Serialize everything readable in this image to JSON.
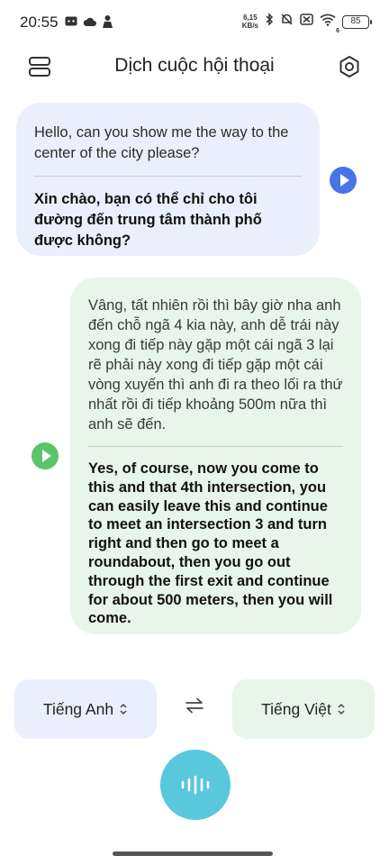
{
  "status_bar": {
    "time": "20:55",
    "net_speed_value": "6,15",
    "net_speed_unit": "KB/s",
    "wifi_badge": "6",
    "battery": "85",
    "icons": [
      "message-icon",
      "cloud-icon",
      "incognito-icon",
      "bluetooth-icon",
      "mute-icon",
      "sim-off-icon",
      "wifi-icon",
      "battery-icon"
    ]
  },
  "header": {
    "title": "Dịch cuộc hội thoại",
    "left_icon": "history-icon",
    "right_icon": "settings-icon"
  },
  "conversation": [
    {
      "source_text": "Hello, can you show me the way to the center of the city please?",
      "translated_text": "Xin chào, bạn có thể chỉ cho tôi đường đến trung tâm thành phố được không?",
      "accent": "#4a73e8"
    },
    {
      "source_text": "Vâng, tất nhiên rồi thì bây giờ nha anh đến chỗ ngã 4 kia này, anh dễ trái này xong đi tiếp này gặp một cái ngã 3 lại rẽ phải này xong đi tiếp gặp một cái vòng xuyến thì anh đi ra theo lối ra thứ nhất rồi đi tiếp khoảng 500m nữa thì anh sẽ đến.",
      "translated_text": "Yes, of course, now you come to this and that 4th intersection, you can easily leave this and continue to meet an intersection 3 and turn right and then go to meet a roundabout, then you go out through the first exit and continue for about 500 meters, then you will come.",
      "accent": "#5bc46c"
    }
  ],
  "languages": {
    "source": "Tiếng Anh",
    "target": "Tiếng Việt"
  },
  "colors": {
    "user_bubble": "#e9effc",
    "reply_bubble": "#e8f5ea",
    "mic": "#59c7dc"
  }
}
